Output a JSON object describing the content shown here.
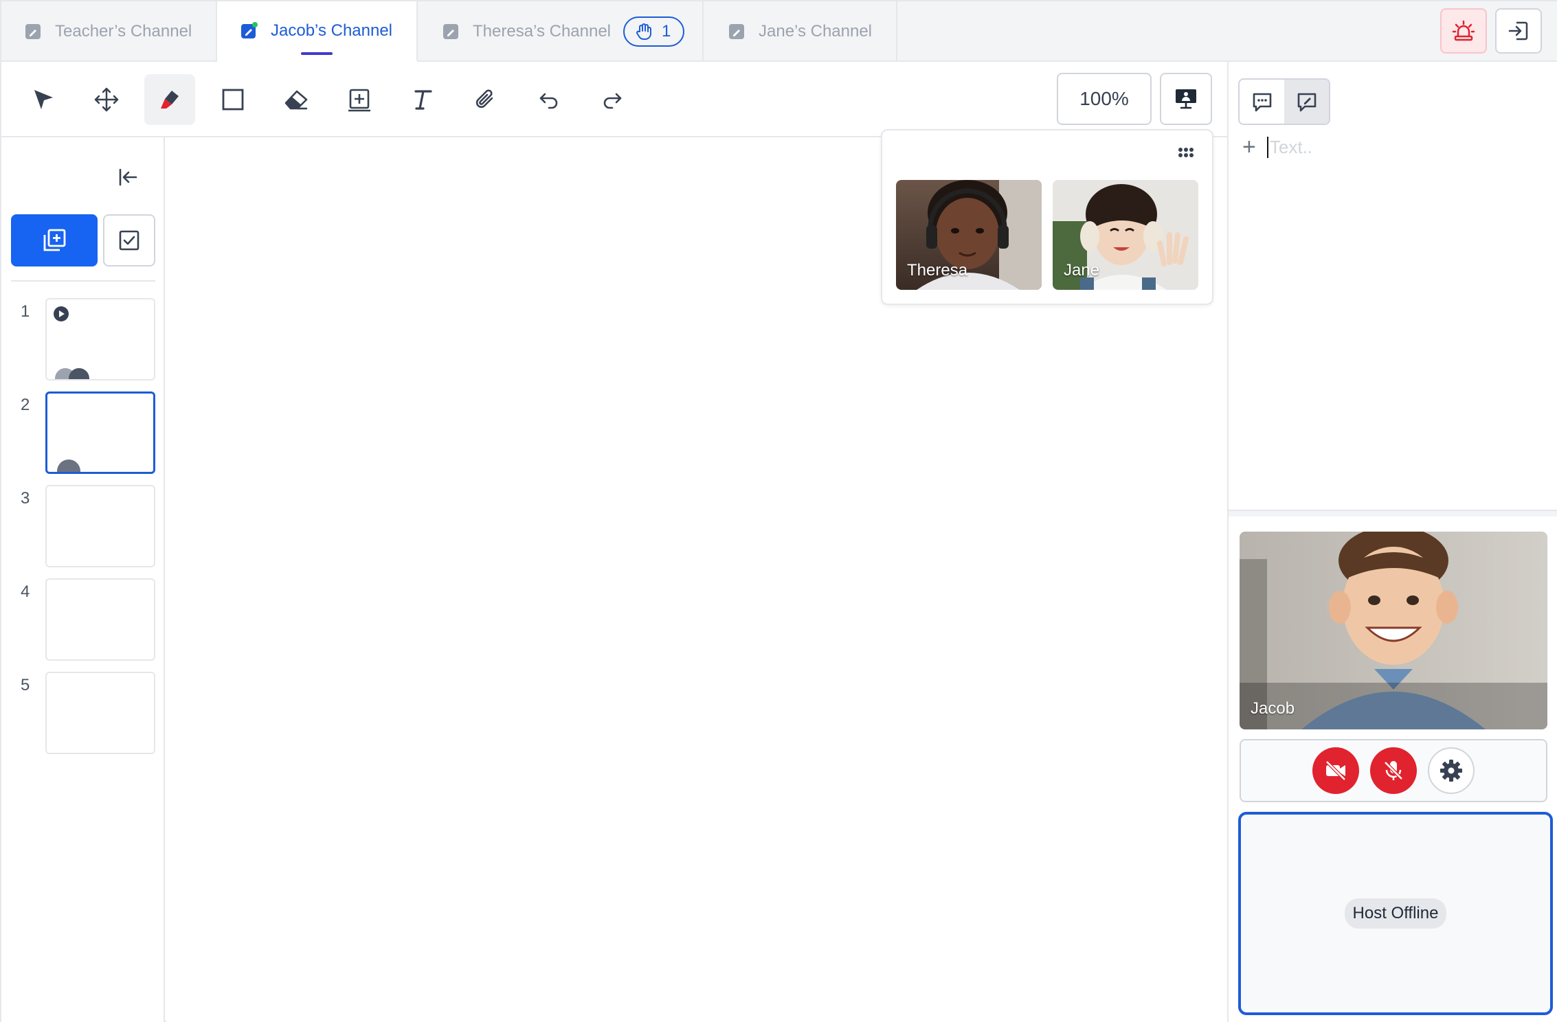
{
  "tabs": [
    {
      "label": "Teacher’s Channel",
      "active": false
    },
    {
      "label": "Jacob’s Channel",
      "active": true
    },
    {
      "label": "Theresa’s Channel",
      "active": false,
      "raised_hands": "1"
    },
    {
      "label": "Jane’s Channel",
      "active": false
    }
  ],
  "topbar": {
    "alarm_icon": "alarm-siren-icon",
    "exit_icon": "exit-icon"
  },
  "toolbar": {
    "tools": [
      "select-arrow-icon",
      "move-icon",
      "pen-icon",
      "rectangle-icon",
      "eraser-icon",
      "add-box-icon",
      "text-icon",
      "attachment-icon",
      "undo-icon",
      "redo-icon"
    ],
    "active_tool": "pen-icon",
    "zoom": "100%"
  },
  "students": [
    {
      "name": "Theresa"
    },
    {
      "name": "Jane"
    }
  ],
  "slides": {
    "items": [
      {
        "number": "1"
      },
      {
        "number": "2"
      },
      {
        "number": "3"
      },
      {
        "number": "4"
      },
      {
        "number": "5"
      }
    ],
    "selected": "2"
  },
  "notes": {
    "placeholder": "Text.."
  },
  "self_video": {
    "name": "Jacob"
  },
  "host": {
    "status": "Host Offline"
  },
  "colors": {
    "accent": "#1d5cd6",
    "primary_button": "#1763f2",
    "danger": "#e0232e"
  }
}
